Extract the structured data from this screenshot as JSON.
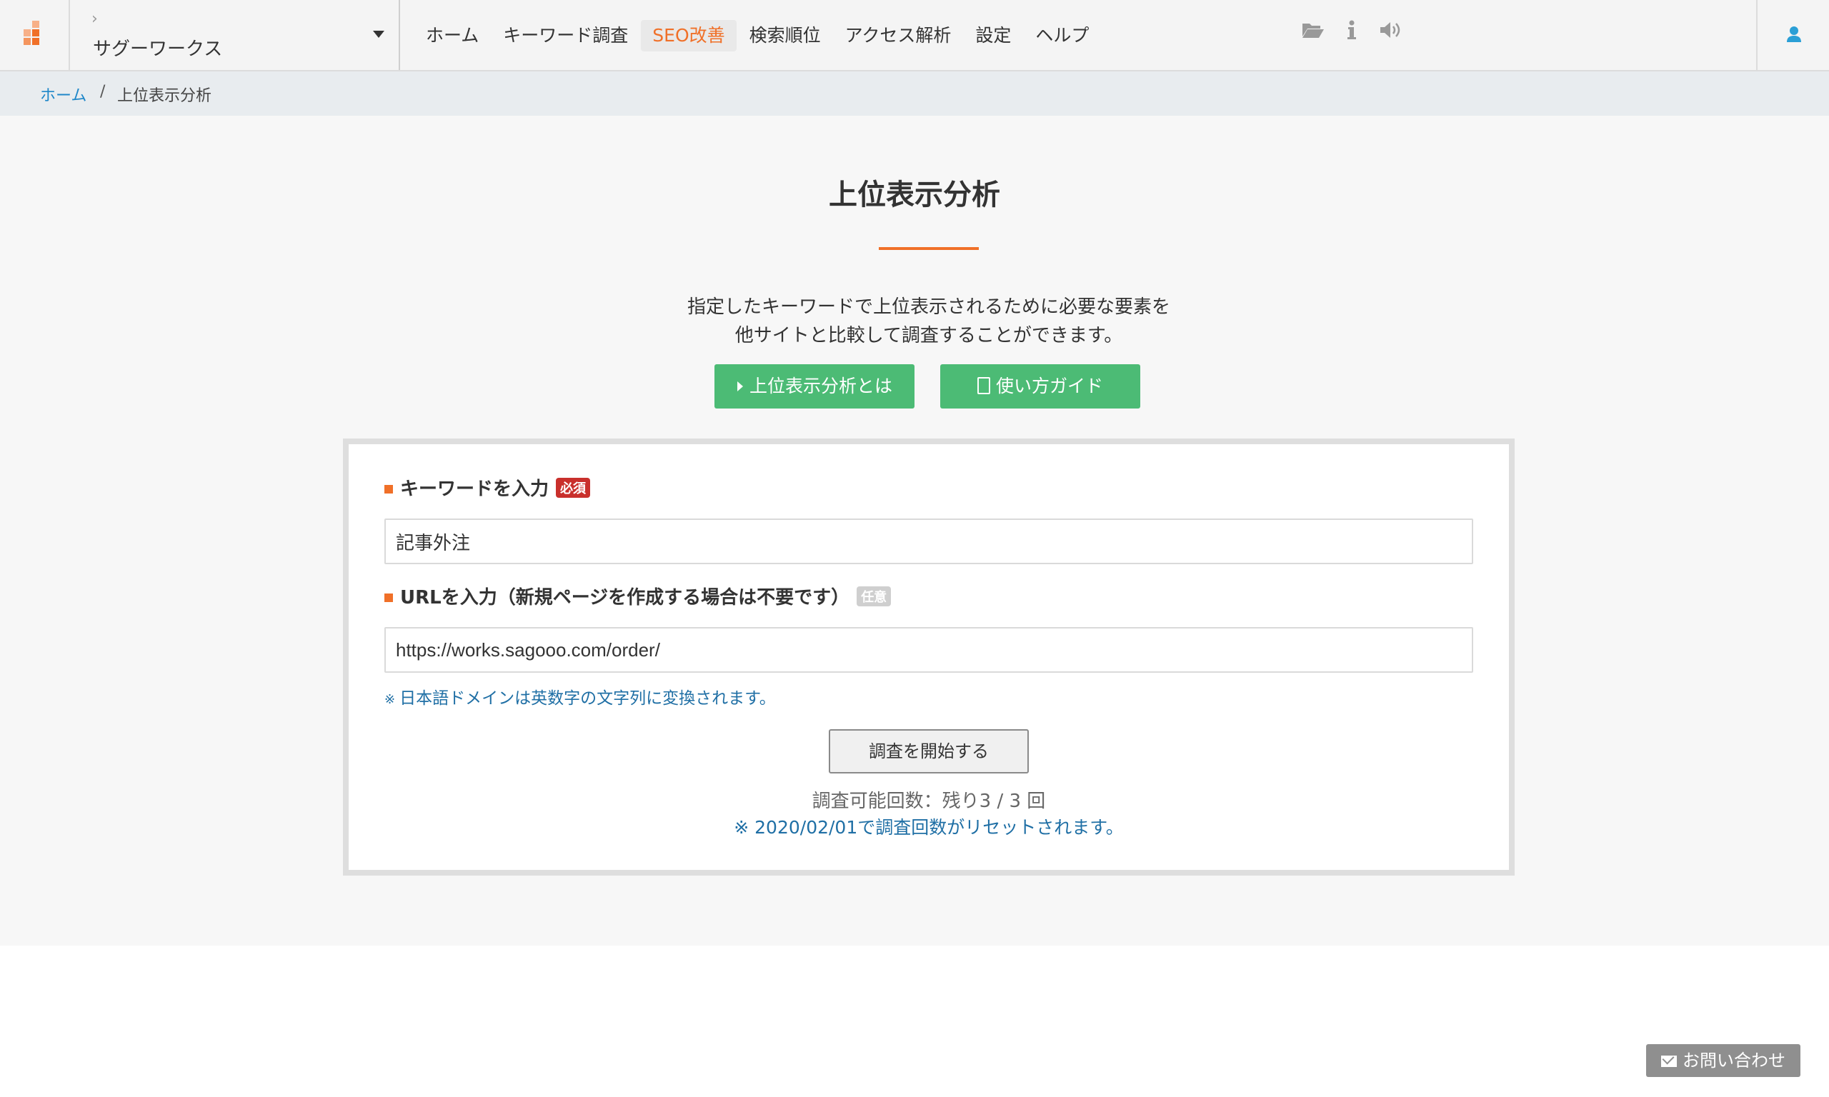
{
  "header": {
    "project_chevron": "›",
    "project_name": "サグーワークス",
    "nav": [
      {
        "label": "ホーム"
      },
      {
        "label": "キーワード調査"
      },
      {
        "label": "SEO改善"
      },
      {
        "label": "検索順位"
      },
      {
        "label": "アクセス解析"
      },
      {
        "label": "設定"
      },
      {
        "label": "ヘルプ"
      }
    ],
    "active_nav": "SEO改善",
    "icons": [
      "folder-open-icon",
      "info-icon",
      "speaker-icon",
      "user-icon"
    ]
  },
  "breadcrumb": {
    "home": "ホーム",
    "separator": "/",
    "current": "上位表示分析"
  },
  "main": {
    "title": "上位表示分析",
    "description_line1": "指定したキーワードで上位表示されるために必要な要素を",
    "description_line2": "他サイトと比較して調査することができます。",
    "about_button": "上位表示分析とは",
    "guide_button": "使い方ガイド"
  },
  "form": {
    "keyword_label": "キーワードを入力",
    "required_badge": "必須",
    "keyword_value": "記事外注",
    "url_label": "URLを入力（新規ページを作成する場合は不要です）",
    "optional_badge": "任意",
    "url_value": "https://works.sagooo.com/order/",
    "note_mark": "※",
    "note": "日本語ドメインは英数字の文字列に変換されます。",
    "submit_label": "調査を開始する",
    "remaining": "調査可能回数：残り3 / 3 回",
    "reset_note": "※ 2020/02/01で調査回数がリセットされます。"
  },
  "contact": {
    "label": "お問い合わせ"
  },
  "colors": {
    "accent": "#f07028",
    "green": "#4cbb75",
    "link": "#1f87c9",
    "required": "#c9302c"
  }
}
